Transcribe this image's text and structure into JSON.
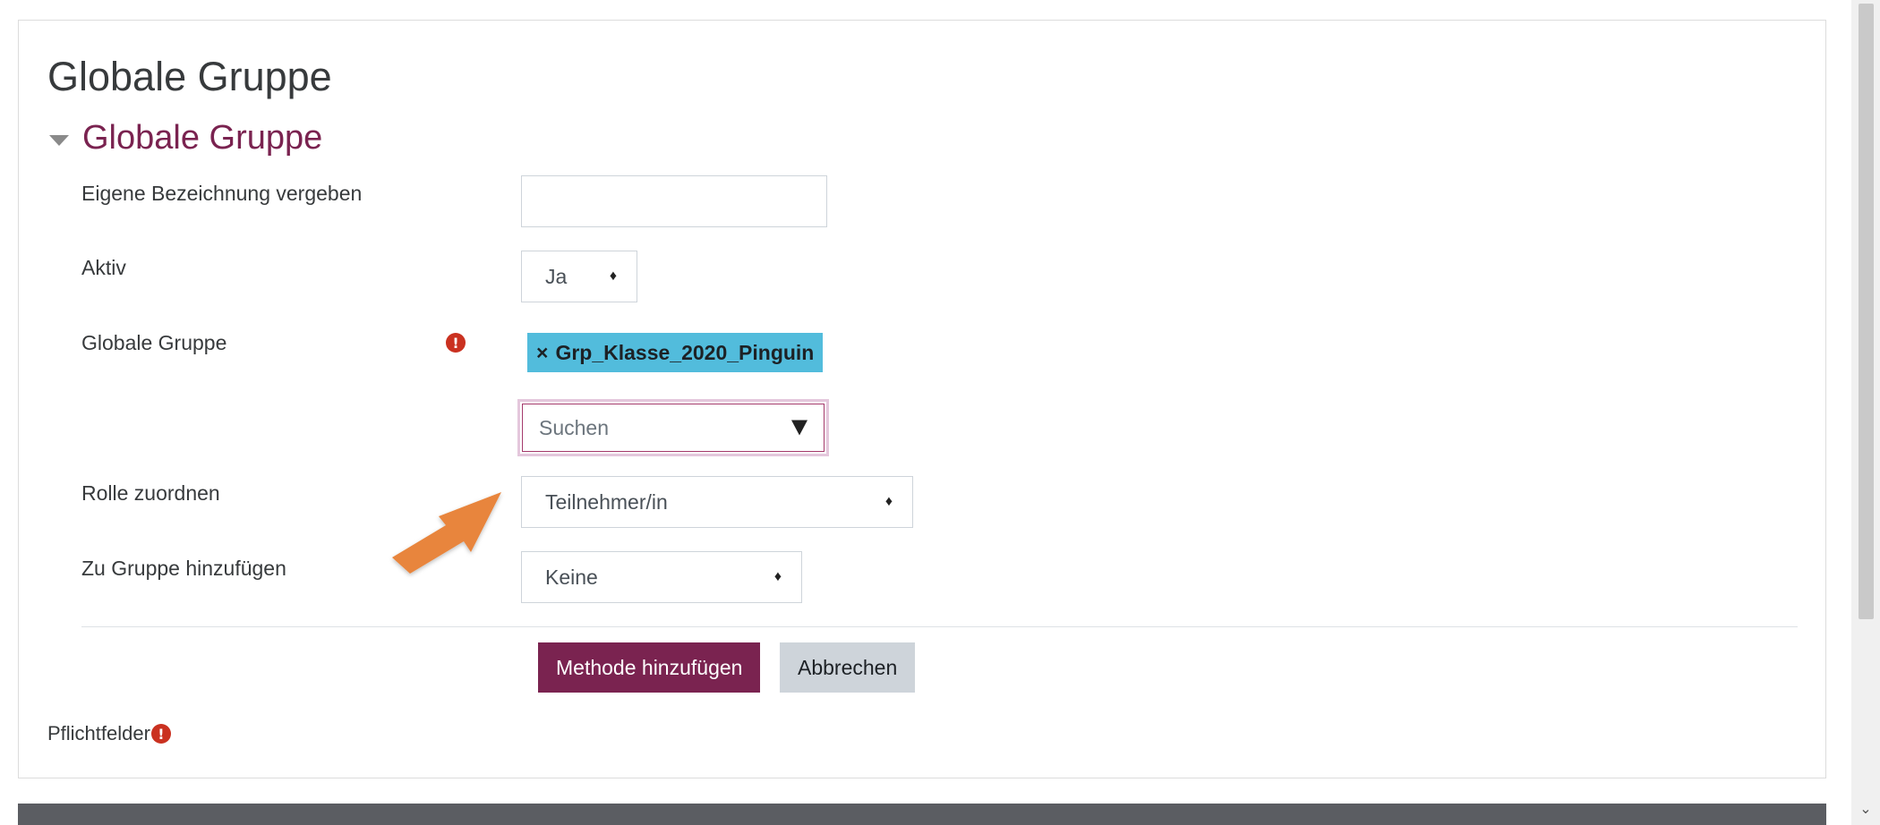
{
  "page": {
    "title": "Globale Gruppe"
  },
  "section": {
    "title": "Globale Gruppe"
  },
  "form": {
    "name_label": "Eigene Bezeichnung vergeben",
    "name_value": "",
    "active_label": "Aktiv",
    "active_value": "Ja",
    "group_label": "Globale Gruppe",
    "selected_tag_close": "×",
    "selected_tag": "Grp_Klasse_2020_Pinguin",
    "search_placeholder": "Suchen",
    "role_label": "Rolle zuordnen",
    "role_value": "Teilnehmer/in",
    "add_group_label": "Zu Gruppe hinzufügen",
    "add_group_value": "Keine"
  },
  "buttons": {
    "submit": "Methode hinzufügen",
    "cancel": "Abbrechen"
  },
  "footer": {
    "required_note": "Pflichtfelder"
  },
  "icons": {
    "required": "exclamation-circle-icon",
    "collapse": "caret-down-icon",
    "select_caret": "sort-updown-icon",
    "dropdown": "triangle-down-icon",
    "annotation_arrow": "arrow-icon"
  },
  "colors": {
    "brand": "#7a2350",
    "tag": "#52bcdc",
    "required": "#ca3120",
    "arrow": "#e8853c"
  }
}
